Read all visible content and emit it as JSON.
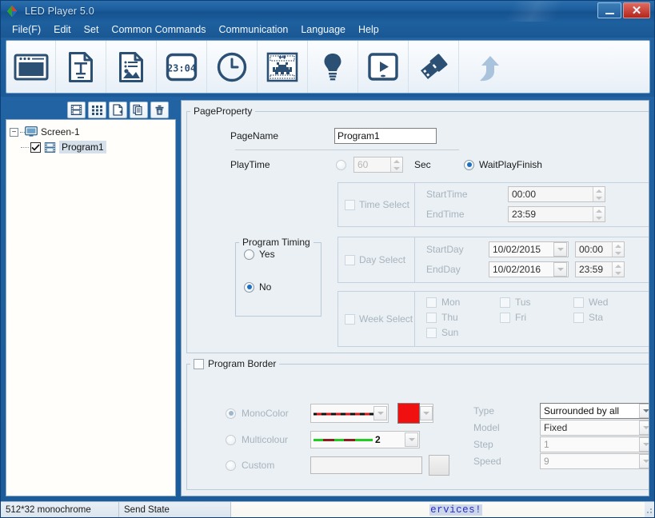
{
  "window": {
    "title": "LED Player 5.0",
    "minimize_label": "_",
    "close_label": "✕"
  },
  "menubar": {
    "items": [
      {
        "label": "File(F)",
        "name": "menu-file"
      },
      {
        "label": "Edit",
        "name": "menu-edit"
      },
      {
        "label": "Set",
        "name": "menu-set"
      },
      {
        "label": "Common Commands",
        "name": "menu-common-commands"
      },
      {
        "label": "Communication",
        "name": "menu-communication"
      },
      {
        "label": "Language",
        "name": "menu-language"
      },
      {
        "label": "Help",
        "name": "menu-help"
      }
    ]
  },
  "toolbar": {
    "buttons": [
      {
        "icon": "screen-window-icon",
        "name": "toolbar-new-screen"
      },
      {
        "icon": "text-document-icon",
        "name": "toolbar-add-text"
      },
      {
        "icon": "picture-document-icon",
        "name": "toolbar-add-picture"
      },
      {
        "icon": "digital-clock-icon",
        "name": "toolbar-add-digital-clock",
        "display": "23:04"
      },
      {
        "icon": "analog-clock-icon",
        "name": "toolbar-add-analog-clock"
      },
      {
        "icon": "animation-icon",
        "name": "toolbar-add-animation"
      },
      {
        "icon": "lightbulb-icon",
        "name": "toolbar-add-neon"
      },
      {
        "icon": "play-screen-icon",
        "name": "toolbar-preview"
      },
      {
        "icon": "usb-drive-icon",
        "name": "toolbar-export-usb"
      },
      {
        "icon": "arrow-up-curve-icon",
        "name": "toolbar-send"
      }
    ]
  },
  "left_panel": {
    "toolbar_buttons": [
      {
        "icon": "film-strip-icon",
        "name": "program-add-button"
      },
      {
        "icon": "grid-icon",
        "name": "area-add-button"
      },
      {
        "icon": "new-page-icon",
        "name": "page-add-button"
      },
      {
        "icon": "copy-icon",
        "name": "copy-button"
      },
      {
        "icon": "trash-icon",
        "name": "delete-button"
      }
    ],
    "tree": {
      "root_label": "Screen-1",
      "root_expander": "−",
      "child_label": "Program1",
      "child_checked": true
    }
  },
  "page_property": {
    "group_title": "PageProperty",
    "page_name_label": "PageName",
    "page_name_value": "Program1",
    "play_time_label": "PlayTime",
    "play_time_selected": false,
    "play_time_value": "60",
    "sec_label": "Sec",
    "wait_play_finish_label": "WaitPlayFinish",
    "wait_play_finish_selected": true,
    "time_select": {
      "checkbox_label": "Time Select",
      "checked": false,
      "start_time_label": "StartTime",
      "start_time_value": "00:00",
      "end_time_label": "EndTime",
      "end_time_value": "23:59"
    },
    "program_timing": {
      "group_title": "Program Timing",
      "yes_label": "Yes",
      "no_label": "No",
      "selected": "No"
    },
    "day_select": {
      "checkbox_label": "Day Select",
      "checked": false,
      "start_day_label": "StartDay",
      "start_day_value": "10/02/2015",
      "start_day_time": "00:00",
      "end_day_label": "EndDay",
      "end_day_value": "10/02/2016",
      "end_day_time": "23:59"
    },
    "week_select": {
      "checkbox_label": "Week Select",
      "checked": false,
      "days": [
        {
          "label": "Mon",
          "checked": false
        },
        {
          "label": "Tus",
          "checked": false
        },
        {
          "label": "Wed",
          "checked": false
        },
        {
          "label": "Thu",
          "checked": false
        },
        {
          "label": "Fri",
          "checked": false
        },
        {
          "label": "Sta",
          "checked": false
        },
        {
          "label": "Sun",
          "checked": false
        }
      ]
    }
  },
  "program_border": {
    "group_title": "Program Border",
    "enabled": false,
    "mono_color_label": "MonoColor",
    "mono_color_selected": true,
    "mono_color_swatch": "#f01010",
    "multicolour_label": "Multicolour",
    "multicolour_selected": false,
    "multicolour_value": "2",
    "custom_label": "Custom",
    "custom_selected": false,
    "custom_value": "",
    "browse_button_label": "",
    "type_label": "Type",
    "type_value": "Surrounded by all",
    "model_label": "Model",
    "model_value": "Fixed",
    "step_label": "Step",
    "step_value": "1",
    "speed_label": "Speed",
    "speed_value": "9"
  },
  "statusbar": {
    "resolution": "512*32 monochrome",
    "send_state": "Send State",
    "marquee_text": "ervices!"
  },
  "colors": {
    "title_bar": "#1b5c9c",
    "panel_bg": "#eaf0f4",
    "accent_radio": "#1b6fc4",
    "swatch_red": "#f01010",
    "marquee_blue": "#2b2bc9"
  }
}
